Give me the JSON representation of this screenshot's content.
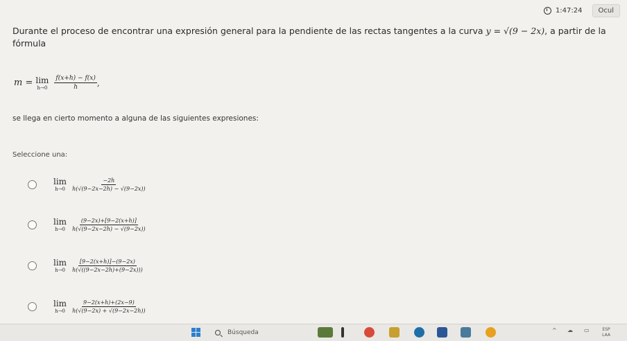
{
  "topbar": {
    "timer": "1:47:24",
    "hide_label": "Ocul"
  },
  "question": {
    "intro": "Durante el proceso de encontrar una expresión general para la pendiente de las rectas tangentes a la curva",
    "curve": "y = √(9 − 2x)",
    "after": ", a partir de la",
    "line2": "fórmula",
    "formula": {
      "lhs": "m =",
      "lim": "lim",
      "sub": "h→0",
      "num": "f(x+h) − f(x)",
      "den": "h",
      "tail": ","
    },
    "prompt": "se llega en cierto momento a alguna de las siguientes expresiones:",
    "select_label": "Seleccione una:",
    "options": [
      {
        "lim": "lim",
        "sub": "h→0",
        "num": "−2h",
        "den": "h(√(9−2x−2h) − √(9−2x))"
      },
      {
        "lim": "lim",
        "sub": "h→0",
        "num": "(9−2x)+[9−2(x+h)]",
        "den": "h(√(9−2x−2h) − √(9−2x))"
      },
      {
        "lim": "lim",
        "sub": "h→0",
        "num": "[9−2(x+h)]−(9−2x)",
        "den": "h(√((9−2x−2h)+(9−2x)))"
      },
      {
        "lim": "lim",
        "sub": "h→0",
        "num": "9−2(x+h)+(2x−9)",
        "den": "h(√(9−2x) + √(9−2x−2h))"
      }
    ]
  },
  "taskbar": {
    "search_placeholder": "Búsqueda",
    "tray_lang": "ESP",
    "tray_sub": "LAA"
  }
}
